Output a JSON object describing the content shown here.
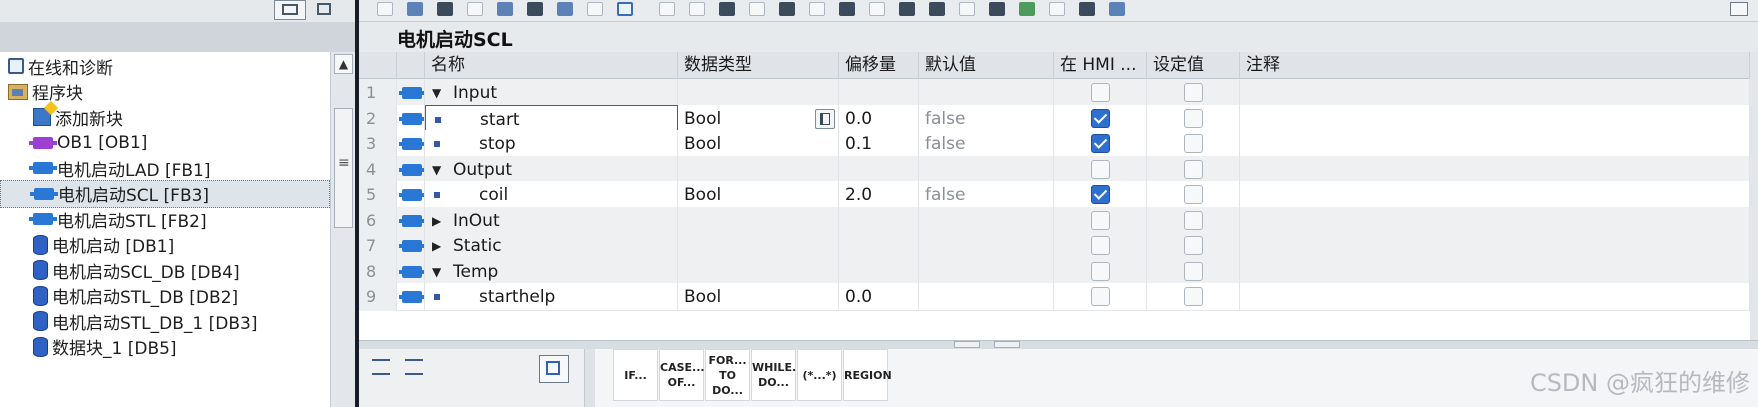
{
  "tree": {
    "items": [
      {
        "icon": "diagnostics-icon",
        "label": "在线和诊断",
        "indent": 0
      },
      {
        "icon": "program-blocks-folder-icon",
        "label": "程序块",
        "indent": 0
      },
      {
        "icon": "add-block-icon",
        "label": "添加新块",
        "indent": 1
      },
      {
        "icon": "ob-block-icon",
        "label": "OB1 [OB1]",
        "indent": 1
      },
      {
        "icon": "fb-block-icon",
        "label": "电机启动LAD [FB1]",
        "indent": 1
      },
      {
        "icon": "fb-block-icon",
        "label": "电机启动SCL [FB3]",
        "indent": 1,
        "selected": true
      },
      {
        "icon": "fb-block-icon",
        "label": "电机启动STL [FB2]",
        "indent": 1
      },
      {
        "icon": "db-block-icon",
        "label": "电机启动 [DB1]",
        "indent": 1
      },
      {
        "icon": "db-block-icon",
        "label": "电机启动SCL_DB [DB4]",
        "indent": 1
      },
      {
        "icon": "db-block-icon",
        "label": "电机启动STL_DB [DB2]",
        "indent": 1
      },
      {
        "icon": "db-block-icon",
        "label": "电机启动STL_DB_1 [DB3]",
        "indent": 1
      },
      {
        "icon": "db-block-icon",
        "label": "数据块_1 [DB5]",
        "indent": 1
      }
    ]
  },
  "editor": {
    "block_title": "电机启动SCL"
  },
  "table": {
    "headers": {
      "name": "名称",
      "datatype": "数据类型",
      "offset": "偏移量",
      "default": "默认值",
      "hmi": "在 HMI ...",
      "setpoint": "设定值",
      "comment": "注释"
    },
    "rows": [
      {
        "num": "1",
        "kind": "group",
        "expander": "▼",
        "name": "Input",
        "type": "",
        "offset": "",
        "default": "",
        "hmi": false,
        "setpoint": false
      },
      {
        "num": "2",
        "kind": "member",
        "name": "start",
        "type": "Bool",
        "offset": "0.0",
        "default": "false",
        "hmi": true,
        "setpoint": false,
        "active": true
      },
      {
        "num": "3",
        "kind": "member",
        "name": "stop",
        "type": "Bool",
        "offset": "0.1",
        "default": "false",
        "hmi": true,
        "setpoint": false
      },
      {
        "num": "4",
        "kind": "group",
        "expander": "▼",
        "name": "Output",
        "type": "",
        "offset": "",
        "default": "",
        "hmi": false,
        "setpoint": false
      },
      {
        "num": "5",
        "kind": "member",
        "name": "coil",
        "type": "Bool",
        "offset": "2.0",
        "default": "false",
        "hmi": true,
        "setpoint": false
      },
      {
        "num": "6",
        "kind": "group",
        "expander": "▶",
        "name": "InOut",
        "type": "",
        "offset": "",
        "default": "",
        "hmi": false,
        "setpoint": false
      },
      {
        "num": "7",
        "kind": "group",
        "expander": "▶",
        "name": "Static",
        "type": "",
        "offset": "",
        "default": "",
        "hmi": false,
        "setpoint": false
      },
      {
        "num": "8",
        "kind": "group",
        "expander": "▼",
        "name": "Temp",
        "type": "",
        "offset": "",
        "default": "",
        "hmi": false,
        "setpoint": false
      },
      {
        "num": "9",
        "kind": "member",
        "name": "starthelp",
        "type": "Bool",
        "offset": "0.0",
        "default": "",
        "hmi": false,
        "setpoint": false
      }
    ]
  },
  "instructions": [
    {
      "line1": "IF...",
      "line2": ""
    },
    {
      "line1": "CASE...",
      "line2": "OF..."
    },
    {
      "line1": "FOR...",
      "line2": "TO DO..."
    },
    {
      "line1": "WHILE..",
      "line2": "DO..."
    },
    {
      "line1": "(*...*)",
      "line2": ""
    },
    {
      "line1": "REGION",
      "line2": ""
    }
  ],
  "watermark": "CSDN @疯狂的维修"
}
